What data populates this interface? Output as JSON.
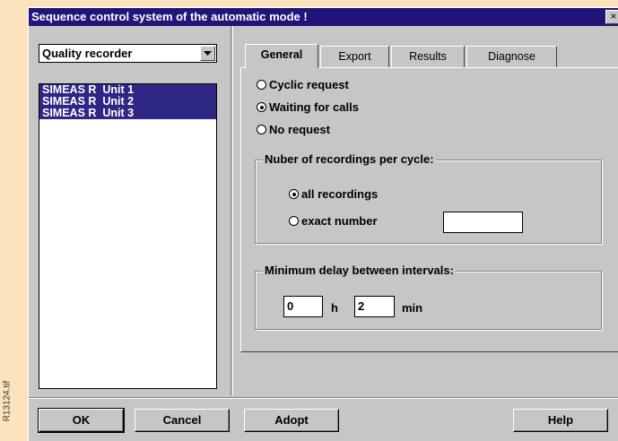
{
  "side_label": "R13124.tif",
  "window": {
    "title": "Sequence control system of the automatic mode !",
    "close_glyph": "×"
  },
  "left": {
    "device_type": "Quality recorder",
    "units": [
      "SIMEAS R  Unit 1",
      "SIMEAS R  Unit 2",
      "SIMEAS R  Unit 3"
    ]
  },
  "tabs": [
    "General",
    "Export",
    "Results",
    "Diagnose"
  ],
  "active_tab": "General",
  "request_options": [
    {
      "label": "Cyclic request",
      "checked": false
    },
    {
      "label": "Waiting for calls",
      "checked": true
    },
    {
      "label": "No request",
      "checked": false
    }
  ],
  "recordings_group": {
    "legend": "Nuber of recordings per cycle:",
    "options": [
      {
        "label": "all recordings",
        "checked": true
      },
      {
        "label": "exact number",
        "checked": false
      }
    ],
    "exact_value": ""
  },
  "delay_group": {
    "legend": "Minimum delay between intervals:",
    "hours": "0",
    "hours_unit": "h",
    "minutes": "2",
    "minutes_unit": "min"
  },
  "buttons": {
    "ok": "OK",
    "cancel": "Cancel",
    "adopt": "Adopt",
    "help": "Help"
  }
}
